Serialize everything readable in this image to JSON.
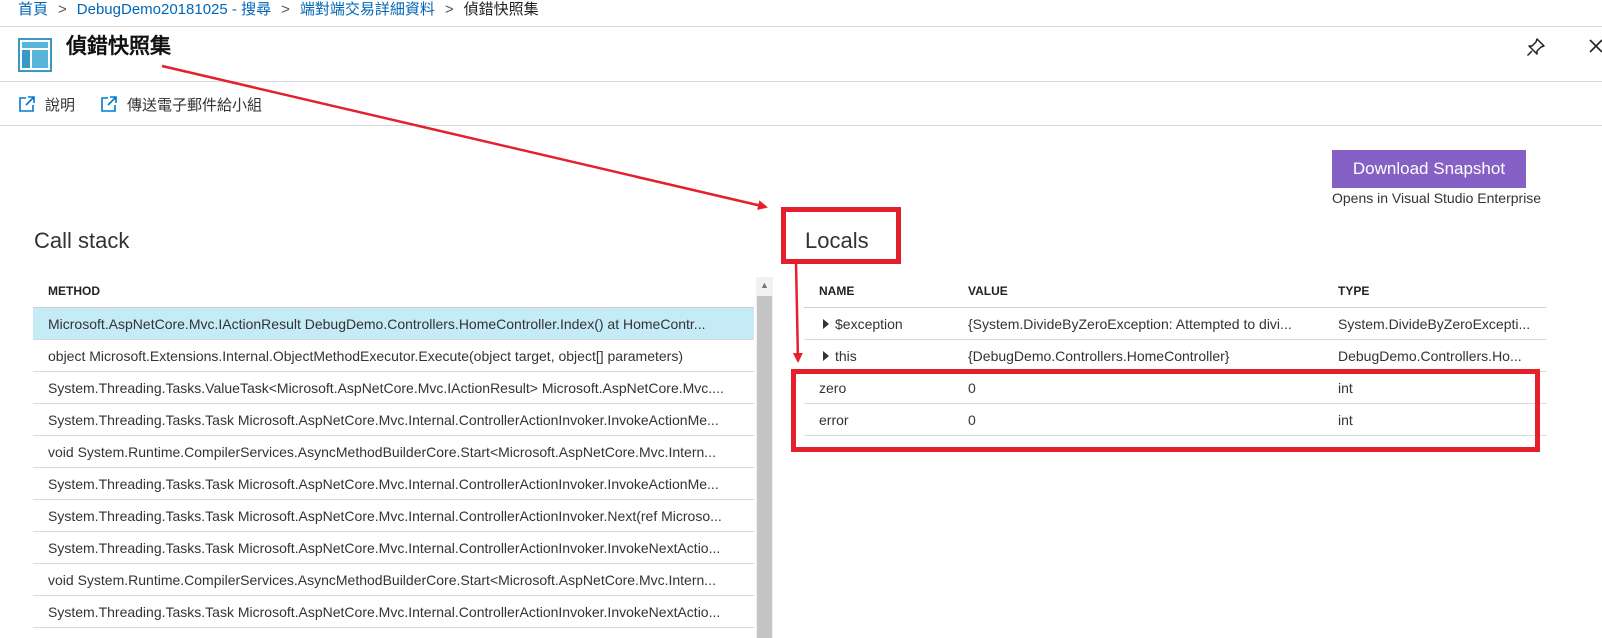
{
  "breadcrumb": {
    "items": [
      "首頁",
      "DebugDemo20181025 - 搜尋",
      "端對端交易詳細資料"
    ],
    "current": "偵錯快照集"
  },
  "header": {
    "title": "偵錯快照集",
    "icon": "blade-icon"
  },
  "commands": [
    {
      "label": "說明",
      "icon": "external-link-icon"
    },
    {
      "label": "傳送電子郵件給小組",
      "icon": "external-link-icon"
    }
  ],
  "download": {
    "button_label": "Download Snapshot",
    "note": "Opens in Visual Studio Enterprise",
    "button_color": "#8661c5"
  },
  "call_stack": {
    "heading": "Call stack",
    "column": "METHOD",
    "rows": [
      "Microsoft.AspNetCore.Mvc.IActionResult DebugDemo.Controllers.HomeController.Index() at HomeContr...",
      "object Microsoft.Extensions.Internal.ObjectMethodExecutor.Execute(object target, object[] parameters)",
      "System.Threading.Tasks.ValueTask<Microsoft.AspNetCore.Mvc.IActionResult> Microsoft.AspNetCore.Mvc....",
      "System.Threading.Tasks.Task Microsoft.AspNetCore.Mvc.Internal.ControllerActionInvoker.InvokeActionMe...",
      "void System.Runtime.CompilerServices.AsyncMethodBuilderCore.Start<Microsoft.AspNetCore.Mvc.Intern...",
      "System.Threading.Tasks.Task Microsoft.AspNetCore.Mvc.Internal.ControllerActionInvoker.InvokeActionMe...",
      "System.Threading.Tasks.Task Microsoft.AspNetCore.Mvc.Internal.ControllerActionInvoker.Next(ref Microso...",
      "System.Threading.Tasks.Task Microsoft.AspNetCore.Mvc.Internal.ControllerActionInvoker.InvokeNextActio...",
      "void System.Runtime.CompilerServices.AsyncMethodBuilderCore.Start<Microsoft.AspNetCore.Mvc.Intern...",
      "System.Threading.Tasks.Task Microsoft.AspNetCore.Mvc.Internal.ControllerActionInvoker.InvokeNextActio..."
    ],
    "selected_index": 0,
    "selected_color": "#c5ebf7"
  },
  "locals": {
    "heading": "Locals",
    "columns": {
      "name": "NAME",
      "value": "VALUE",
      "type": "TYPE"
    },
    "rows": [
      {
        "name": "$exception",
        "value": "{System.DivideByZeroException: Attempted to divi...",
        "type": "System.DivideByZeroExcepti...",
        "expandable": true
      },
      {
        "name": "this",
        "value": "{DebugDemo.Controllers.HomeController}",
        "type": "DebugDemo.Controllers.Ho...",
        "expandable": true
      },
      {
        "name": "zero",
        "value": "0",
        "type": "int",
        "expandable": false
      },
      {
        "name": "error",
        "value": "0",
        "type": "int",
        "expandable": false
      }
    ]
  },
  "annotation_color": "#e3202b"
}
